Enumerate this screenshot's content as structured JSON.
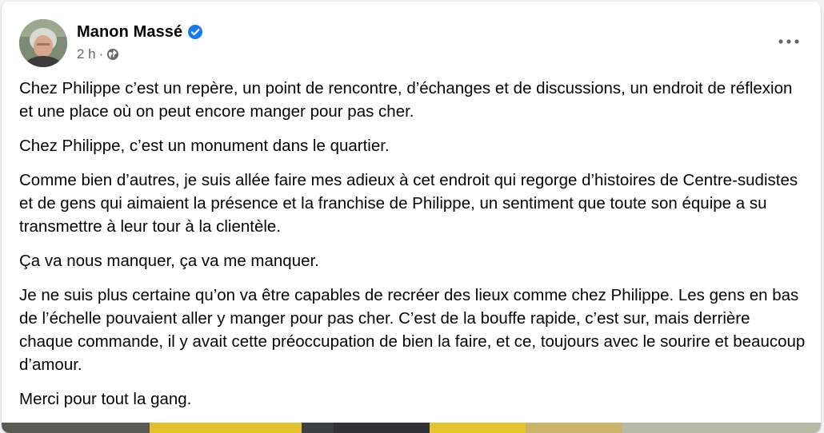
{
  "post": {
    "author_name": "Manon Massé",
    "time_ago": "2 h",
    "separator": "·",
    "verified_icon": "verified-badge-icon",
    "privacy_icon": "globe-icon",
    "more_icon": "more-options-icon",
    "paragraphs": [
      "Chez Philippe c’est un repère, un point de rencontre, d’échanges et de discussions, un endroit de réflexion et une place où on peut encore manger pour pas cher.",
      "Chez Philippe, c’est un monument dans le quartier.",
      "Comme bien d’autres, je suis allée faire mes adieux à cet endroit qui regorge d’histoires de Centre-sudistes et de gens qui aimaient la présence et la franchise de Philippe, un sentiment que toute son équipe a su transmettre à leur tour à la clientèle.",
      "Ça va nous manquer, ça va me manquer.",
      "Je ne suis plus certaine qu’on va être capables de recréer des lieux comme chez Philippe.  Les gens en bas de l’échelle pouvaient aller y manger pour pas cher. C’est de la bouffe rapide, c’est sur, mais derrière chaque commande, il y avait cette préoccupation de bien la faire, et ce, toujours avec le sourire et beaucoup d’amour.",
      "Merci pour tout la gang."
    ]
  },
  "colors": {
    "verified_blue": "#1877f2",
    "secondary_text": "#65676b",
    "primary_text": "#050505"
  }
}
